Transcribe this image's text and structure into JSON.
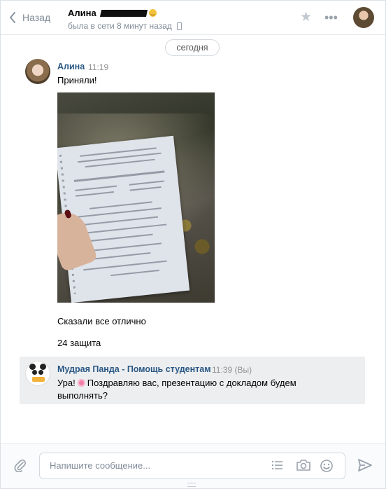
{
  "header": {
    "back_label": "Назад",
    "contact_name": "Алина",
    "status": "была в сети 8 минут назад"
  },
  "date_divider": "сегодня",
  "messages": [
    {
      "author": "Алина",
      "time": "11:19",
      "texts": [
        "Приняли!",
        "Сказали все отлично",
        "24 защита"
      ],
      "has_photo": true
    },
    {
      "author": "Мудрая Панда - Помощь студентам",
      "time": "11:39",
      "you_label": "(Вы)",
      "text_line1_a": "Ура!",
      "text_line1_b": "Поздравляю вас, презентацию с докладом будем",
      "text_line2": "выполнять?"
    }
  ],
  "composer": {
    "placeholder": "Напишите сообщение..."
  },
  "icons": {
    "back": "chevron-left-icon",
    "favorite": "star-icon",
    "more": "more-dots-icon",
    "attach": "paperclip-icon",
    "templates": "list-icon",
    "camera": "camera-icon",
    "emoji": "smile-icon",
    "send": "send-icon"
  },
  "colors": {
    "link": "#2a5885",
    "muted": "#818c99",
    "highlight_bg": "#edeef0"
  }
}
